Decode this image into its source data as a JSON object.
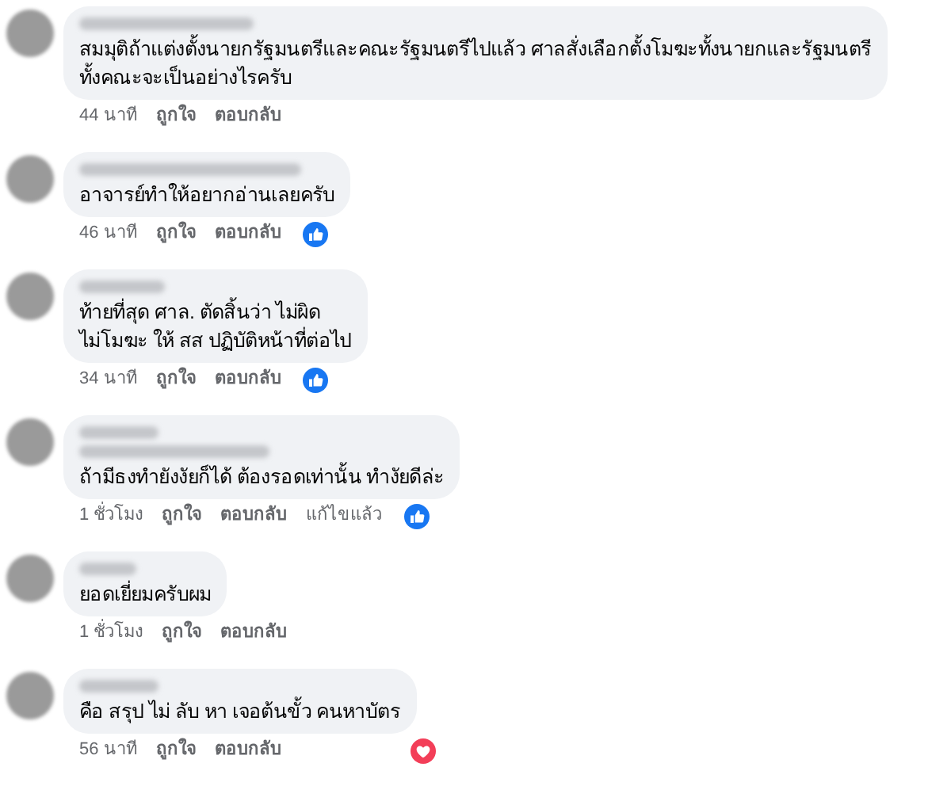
{
  "comments": [
    {
      "second_name_line": false,
      "lines": [
        "สมมุติถ้าแต่งตั้งนายกรัฐมนตรีและคณะรัฐมนตรีไปแล้ว ศาลสั่งเลือกตั้งโมฆะทั้งนายกและรัฐมนตรี",
        "ทั้งคณะจะเป็นอย่างไรครับ"
      ],
      "time": "44 นาที",
      "like": "ถูกใจ",
      "reply": "ตอบกลับ",
      "liked": false,
      "loved": false
    },
    {
      "second_name_line": false,
      "lines": [
        "อาจารย์ทำให้อยากอ่านเลยครับ"
      ],
      "time": "46 นาที",
      "like": "ถูกใจ",
      "reply": "ตอบกลับ",
      "liked": true,
      "loved": false
    },
    {
      "second_name_line": false,
      "lines": [
        "ท้ายที่สุด ศาล. ตัดสิ้นว่า ไม่ผิด",
        "ไม่โมฆะ ให้ สส ปฏิบัติหน้าที่ต่อไป"
      ],
      "time": "34 นาที",
      "like": "ถูกใจ",
      "reply": "ตอบกลับ",
      "liked": true,
      "loved": false
    },
    {
      "second_name_line": true,
      "lines": [
        "ถ้ามีธงทำยังงัยก็ได้ ต้องรอดเท่านั้น ทำงัยดีล่ะ"
      ],
      "time": "1 ชั่วโมง",
      "like": "ถูกใจ",
      "reply": "ตอบกลับ",
      "edited": "แก้ไขแล้ว",
      "liked": true,
      "loved": false
    },
    {
      "second_name_line": false,
      "lines": [
        "ยอดเยี่ยมครับผม"
      ],
      "time": "1 ชั่วโมง",
      "like": "ถูกใจ",
      "reply": "ตอบกลับ",
      "liked": false,
      "loved": false
    },
    {
      "second_name_line": false,
      "lines": [
        "คือ สรุป ไม่ ลับ หา เจอต้นขั้ว คนหาบัตร"
      ],
      "time": "56 นาที",
      "like": "ถูกใจ",
      "reply": "ตอบกลับ",
      "liked": false,
      "loved": true
    }
  ]
}
